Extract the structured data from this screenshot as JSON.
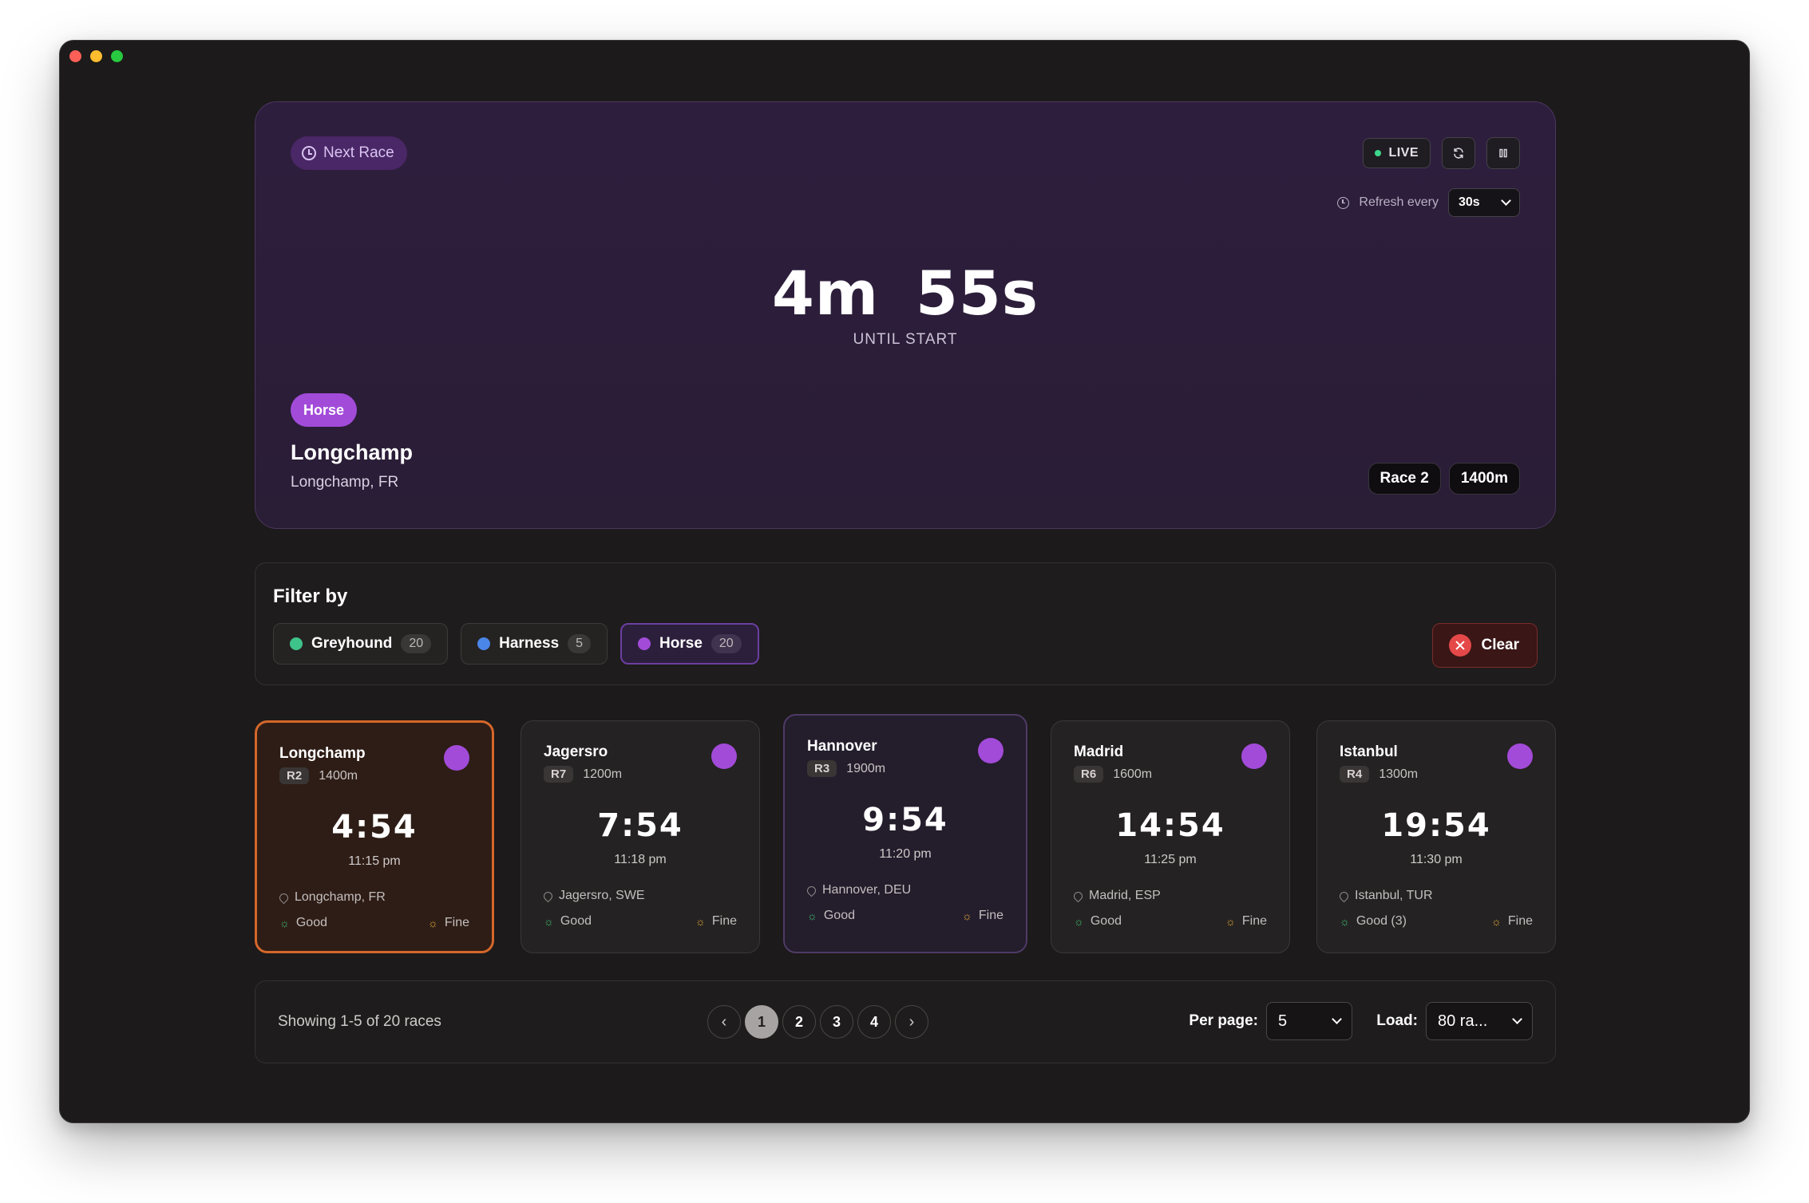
{
  "hero": {
    "next_race_label": "Next Race",
    "live_label": "LIVE",
    "refresh_label": "Refresh every",
    "refresh_value": "30s",
    "countdown_minutes": "4m",
    "countdown_seconds": "55s",
    "until_label": "UNTIL START",
    "type_label": "Horse",
    "venue": "Longchamp",
    "location": "Longchamp, FR",
    "race_label": "Race 2",
    "distance": "1400m"
  },
  "filter": {
    "title": "Filter by",
    "chips": [
      {
        "label": "Greyhound",
        "count": "20",
        "color": "#3ec38a"
      },
      {
        "label": "Harness",
        "count": "5",
        "color": "#4a86e8"
      },
      {
        "label": "Horse",
        "count": "20",
        "color": "#a24bd9"
      }
    ],
    "clear_label": "Clear"
  },
  "cards": [
    {
      "name": "Longchamp",
      "race": "R2",
      "distance": "1400m",
      "countdown": "4:54",
      "time": "11:15 pm",
      "location": "Longchamp, FR",
      "track": "Good",
      "weather": "Fine"
    },
    {
      "name": "Jagersro",
      "race": "R7",
      "distance": "1200m",
      "countdown": "7:54",
      "time": "11:18 pm",
      "location": "Jagersro, SWE",
      "track": "Good",
      "weather": "Fine"
    },
    {
      "name": "Hannover",
      "race": "R3",
      "distance": "1900m",
      "countdown": "9:54",
      "time": "11:20 pm",
      "location": "Hannover, DEU",
      "track": "Good",
      "weather": "Fine"
    },
    {
      "name": "Madrid",
      "race": "R6",
      "distance": "1600m",
      "countdown": "14:54",
      "time": "11:25 pm",
      "location": "Madrid, ESP",
      "track": "Good",
      "weather": "Fine"
    },
    {
      "name": "Istanbul",
      "race": "R4",
      "distance": "1300m",
      "countdown": "19:54",
      "time": "11:30 pm",
      "location": "Istanbul, TUR",
      "track": "Good (3)",
      "weather": "Fine"
    }
  ],
  "pagination": {
    "showing": "Showing 1-5 of 20 races",
    "pages": [
      "1",
      "2",
      "3",
      "4"
    ],
    "current_page": "1",
    "per_page_label": "Per page:",
    "per_page_value": "5",
    "load_label": "Load:",
    "load_value": "80 ra..."
  }
}
